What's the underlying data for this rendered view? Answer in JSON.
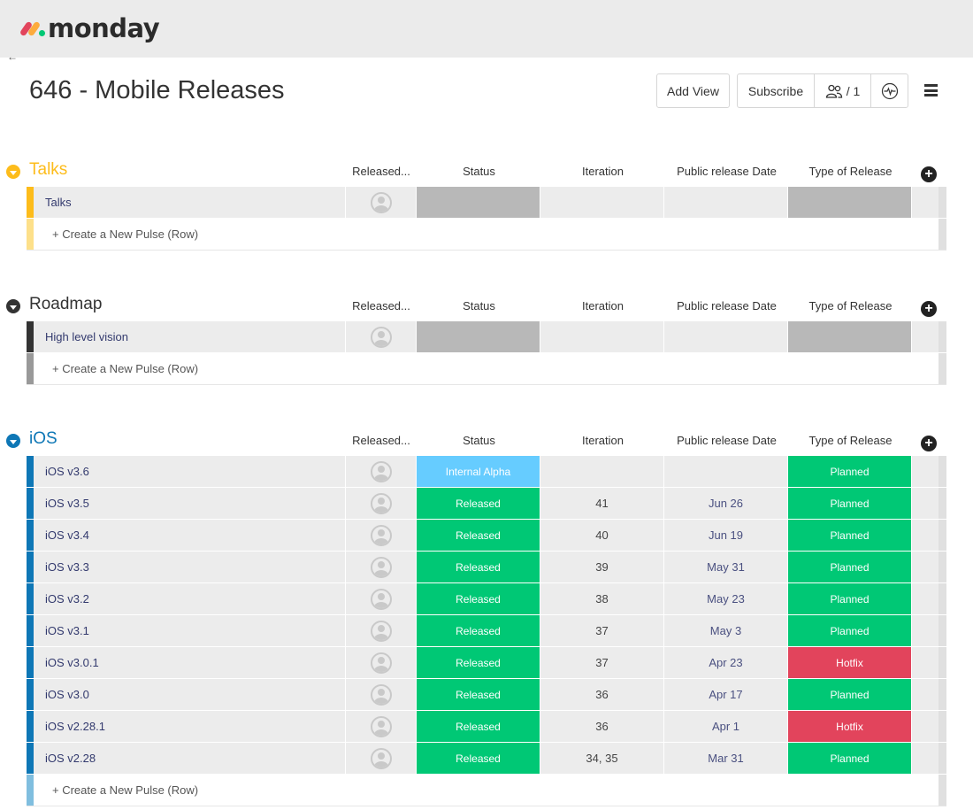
{
  "app": {
    "logo_text": "monday"
  },
  "board": {
    "title": "646 - Mobile Releases"
  },
  "toolbar": {
    "add_view_label": "Add View",
    "subscribe_label": "Subscribe",
    "members_count": "/ 1",
    "activity_icon": "activity-pulse-icon",
    "menu_icon": "hamburger-menu-icon"
  },
  "columns": {
    "released_by": "Released...",
    "status": "Status",
    "iteration": "Iteration",
    "public_release_date": "Public release Date",
    "type_of_release": "Type of Release"
  },
  "colors": {
    "released": "#00c875",
    "internal_alpha": "#66ccff",
    "planned": "#00c875",
    "hotfix": "#e2445c",
    "empty_label": "#b8b8b8"
  },
  "new_row_label": "+ Create a New Pulse (Row)",
  "groups": [
    {
      "name": "Talks",
      "color": "#fdbc1b",
      "new_row_strip": "#fde08a",
      "rows": [
        {
          "name": "Talks",
          "status": "",
          "status_color": "#b8b8b8",
          "iteration": "",
          "date": "",
          "type": "",
          "type_color": "#b8b8b8"
        }
      ]
    },
    {
      "name": "Roadmap",
      "color": "#333333",
      "new_row_strip": "#999999",
      "rows": [
        {
          "name": "High level vision",
          "status": "",
          "status_color": "#b8b8b8",
          "iteration": "",
          "date": "",
          "type": "",
          "type_color": "#b8b8b8"
        }
      ]
    },
    {
      "name": "iOS",
      "color": "#0e77b6",
      "new_row_strip": "#80bedf",
      "rows": [
        {
          "name": "iOS v3.6",
          "status": "Internal Alpha",
          "status_color": "#66ccff",
          "iteration": "",
          "date": "",
          "type": "Planned",
          "type_color": "#00c875"
        },
        {
          "name": "iOS v3.5",
          "status": "Released",
          "status_color": "#00c875",
          "iteration": "41",
          "date": "Jun 26",
          "type": "Planned",
          "type_color": "#00c875"
        },
        {
          "name": "iOS v3.4",
          "status": "Released",
          "status_color": "#00c875",
          "iteration": "40",
          "date": "Jun 19",
          "type": "Planned",
          "type_color": "#00c875"
        },
        {
          "name": "iOS v3.3",
          "status": "Released",
          "status_color": "#00c875",
          "iteration": "39",
          "date": "May 31",
          "type": "Planned",
          "type_color": "#00c875"
        },
        {
          "name": "iOS v3.2",
          "status": "Released",
          "status_color": "#00c875",
          "iteration": "38",
          "date": "May 23",
          "type": "Planned",
          "type_color": "#00c875"
        },
        {
          "name": "iOS v3.1",
          "status": "Released",
          "status_color": "#00c875",
          "iteration": "37",
          "date": "May 3",
          "type": "Planned",
          "type_color": "#00c875"
        },
        {
          "name": "iOS v3.0.1",
          "status": "Released",
          "status_color": "#00c875",
          "iteration": "37",
          "date": "Apr 23",
          "type": "Hotfix",
          "type_color": "#e2445c"
        },
        {
          "name": "iOS v3.0",
          "status": "Released",
          "status_color": "#00c875",
          "iteration": "36",
          "date": "Apr 17",
          "type": "Planned",
          "type_color": "#00c875"
        },
        {
          "name": "iOS v2.28.1",
          "status": "Released",
          "status_color": "#00c875",
          "iteration": "36",
          "date": "Apr 1",
          "type": "Hotfix",
          "type_color": "#e2445c"
        },
        {
          "name": "iOS v2.28",
          "status": "Released",
          "status_color": "#00c875",
          "iteration": "34, 35",
          "date": "Mar 31",
          "type": "Planned",
          "type_color": "#00c875"
        }
      ]
    }
  ]
}
